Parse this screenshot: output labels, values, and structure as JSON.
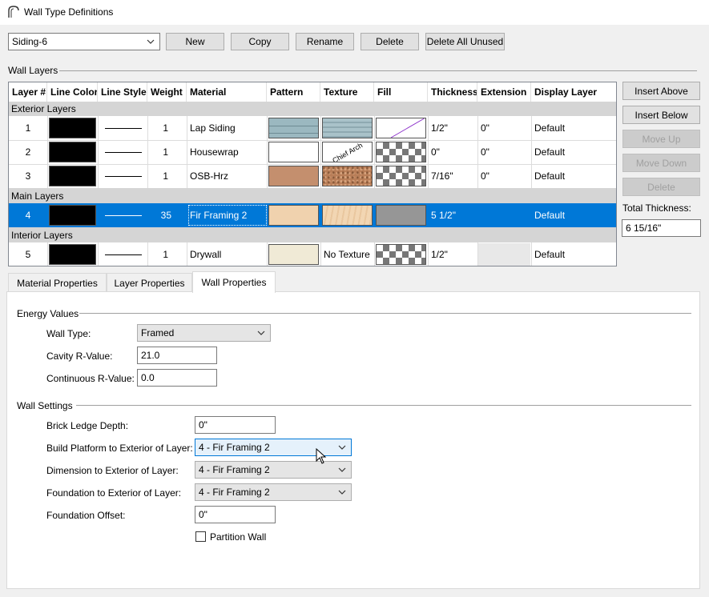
{
  "window": {
    "title": "Wall Type Definitions"
  },
  "toolbar": {
    "wall_type_selected": "Siding-6",
    "new_label": "New",
    "copy_label": "Copy",
    "rename_label": "Rename",
    "delete_label": "Delete",
    "delete_all_unused_label": "Delete All Unused"
  },
  "wall_layers": {
    "group_label": "Wall Layers",
    "columns": [
      "Layer #",
      "Line Color",
      "Line Style",
      "Weight",
      "Material",
      "Pattern",
      "Texture",
      "Fill",
      "Thickness",
      "Extension",
      "Display Layer"
    ],
    "sections": {
      "exterior": "Exterior Layers",
      "main": "Main Layers",
      "interior": "Interior Layers"
    },
    "rows": [
      {
        "layer": "1",
        "weight": "1",
        "material": "Lap Siding",
        "texture": "",
        "thickness": "1/2\"",
        "extension": "0\"",
        "display_layer": "Default"
      },
      {
        "layer": "2",
        "weight": "1",
        "material": "Housewrap",
        "texture": "",
        "thickness": "0\"",
        "extension": "0\"",
        "display_layer": "Default"
      },
      {
        "layer": "3",
        "weight": "1",
        "material": "OSB-Hrz",
        "texture": "",
        "thickness": "7/16\"",
        "extension": "0\"",
        "display_layer": "Default"
      },
      {
        "layer": "4",
        "weight": "35",
        "material": "Fir Framing 2",
        "texture": "",
        "thickness": "5 1/2\"",
        "extension": "",
        "display_layer": "Default"
      },
      {
        "layer": "5",
        "weight": "1",
        "material": "Drywall",
        "texture": "No Texture",
        "thickness": "1/2\"",
        "extension": "",
        "display_layer": "Default"
      }
    ],
    "housewrap_texture_text": "Chief Arch",
    "colors": {
      "selected_row": "#0078d7",
      "lap_siding": "#9bb8c0",
      "osb": "#c48f6e",
      "fir": "#f0d2ae",
      "drywall": "#f0ead6",
      "fill_gray": "#969696"
    }
  },
  "side_buttons": {
    "insert_above": "Insert Above",
    "insert_below": "Insert Below",
    "move_up": "Move Up",
    "move_down": "Move Down",
    "delete": "Delete",
    "total_thickness_label": "Total Thickness:",
    "total_thickness_value": "6 15/16\""
  },
  "tabs": {
    "material_properties": "Material Properties",
    "layer_properties": "Layer Properties",
    "wall_properties": "Wall Properties",
    "active": "Wall Properties"
  },
  "energy": {
    "group_label": "Energy Values",
    "wall_type_label": "Wall Type:",
    "wall_type_value": "Framed",
    "cavity_label": "Cavity R-Value:",
    "cavity_value": "21.0",
    "continuous_label": "Continuous R-Value:",
    "continuous_value": "0.0"
  },
  "wall_settings": {
    "group_label": "Wall Settings",
    "brick_ledge_label": "Brick Ledge Depth:",
    "brick_ledge_value": "0\"",
    "build_platform_label": "Build Platform to Exterior of Layer:",
    "build_platform_value": "4 - Fir Framing 2",
    "dimension_label": "Dimension to Exterior of Layer:",
    "dimension_value": "4 - Fir Framing 2",
    "foundation_label": "Foundation to Exterior of Layer:",
    "foundation_value": "4 - Fir Framing 2",
    "foundation_offset_label": "Foundation Offset:",
    "foundation_offset_value": "0\"",
    "partition_wall_label": "Partition Wall",
    "partition_wall_checked": false
  }
}
